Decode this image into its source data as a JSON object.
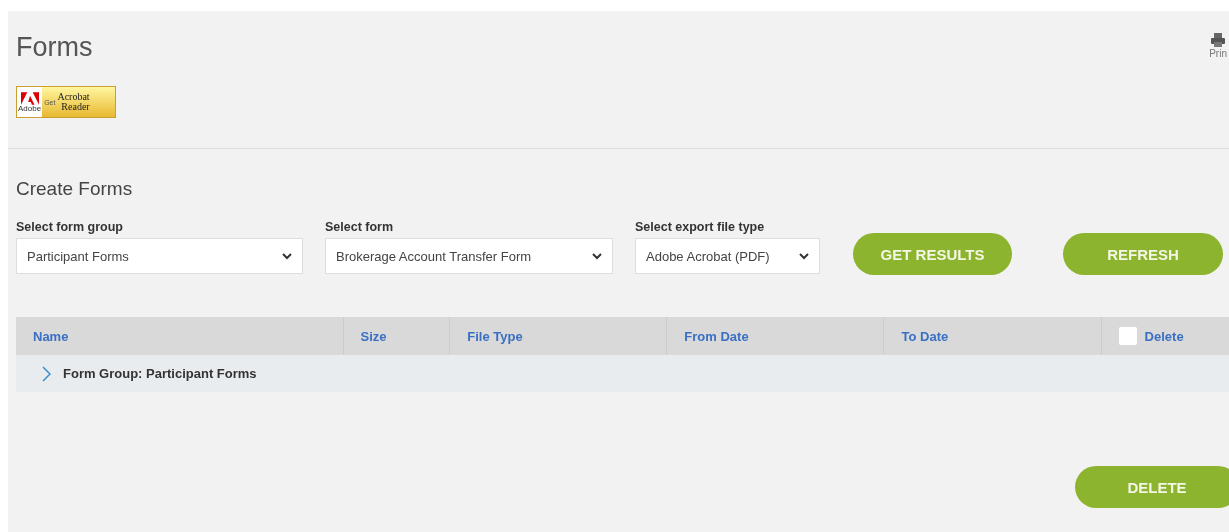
{
  "page": {
    "title": "Forms",
    "print_label": "Prin"
  },
  "acrobat_badge": {
    "get": "Get",
    "acrobat": "Acrobat",
    "reader": "Reader",
    "adobe": "Adobe"
  },
  "section": {
    "title": "Create Forms"
  },
  "filters": [
    {
      "label": "Select form group",
      "value": "Participant Forms"
    },
    {
      "label": "Select form",
      "value": "Brokerage Account Transfer Form"
    },
    {
      "label": "Select export file type",
      "value": "Adobe Acrobat (PDF)"
    }
  ],
  "actions": [
    "GET RESULTS",
    "REFRESH"
  ],
  "table": {
    "columns": [
      "Name",
      "Size",
      "File Type",
      "From Date",
      "To Date",
      "Delete"
    ],
    "select_all_checked": false,
    "groups": [
      {
        "label": "Form Group: Participant Forms",
        "expanded": false
      }
    ]
  },
  "footer_button": "DELETE"
}
